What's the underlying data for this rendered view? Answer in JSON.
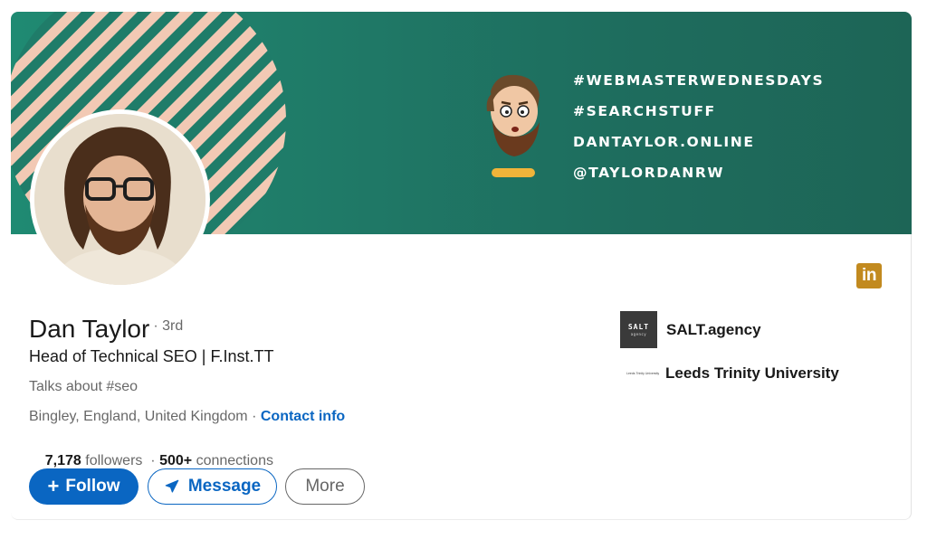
{
  "profile": {
    "name": "Dan Taylor",
    "degree": "· 3rd",
    "headline": "Head of Technical SEO | F.Inst.TT",
    "talks_about": "Talks about #seo",
    "location": "Bingley, England, United Kingdom",
    "location_separator": " · ",
    "contact_info_label": "Contact info",
    "followers_count": "7,178",
    "followers_label": " followers",
    "stats_separator": "  · ",
    "connections_count": "500+",
    "connections_label": " connections"
  },
  "banner": {
    "lines": [
      "#WEBMASTERWEDNESDAYS",
      "#SEARCHSTUFF",
      "DANTAYLOR.ONLINE",
      "@TAYLORDANRW"
    ],
    "colors": {
      "stripe_light": "#f2c9b4",
      "stripe_dark": "#1f7c69",
      "accent_yellow": "#f0b43a"
    }
  },
  "actions": {
    "follow_icon": "+",
    "follow_label": "Follow",
    "message_icon": "paper-plane-icon",
    "message_label": "Message",
    "more_label": "More"
  },
  "companies": [
    {
      "logo_text": "SALT",
      "logo_subtext": "agency",
      "name": "SALT.agency"
    },
    {
      "logo_text": "Leeds Trinity University",
      "name": "Leeds Trinity University"
    }
  ],
  "linkedin_badge": "in",
  "colors": {
    "primary": "#0a66c2",
    "linkedin_badge": "#c28a1f",
    "text_secondary": "#666666"
  }
}
